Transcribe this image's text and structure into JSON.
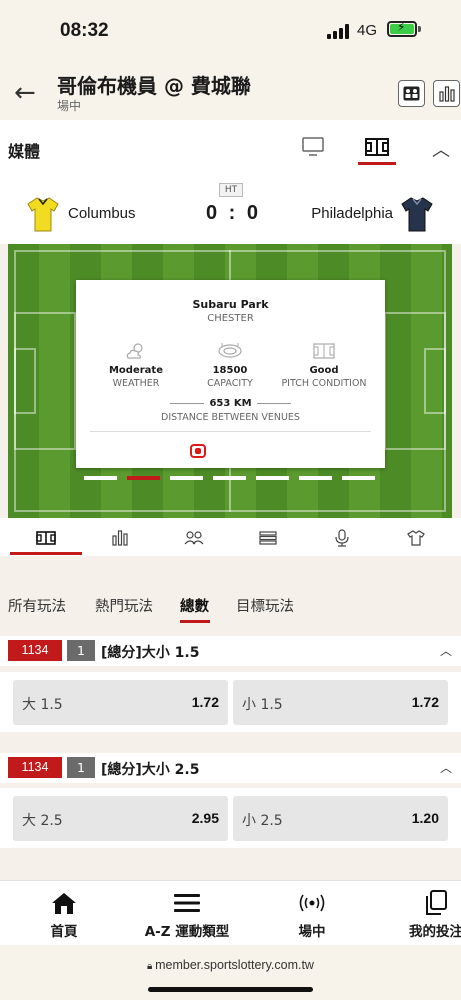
{
  "status_bar": {
    "time": "08:32",
    "network": "4G",
    "battery": "charging"
  },
  "header": {
    "title": "哥倫布機員 @ 費城聯",
    "subtitle": "場中"
  },
  "media": {
    "label": "媒體"
  },
  "match": {
    "period": "HT",
    "home_team": "Columbus",
    "away_team": "Philadelphia",
    "score": "0 : 0",
    "home_shirt_color": "#f2dc21",
    "away_shirt_color": "#25344a"
  },
  "venue_card": {
    "venue": "Subaru Park",
    "city": "CHESTER",
    "stats": [
      {
        "value": "Moderate",
        "label": "WEATHER",
        "icon": "weather-icon"
      },
      {
        "value": "18500",
        "label": "CAPACITY",
        "icon": "stadium-icon"
      },
      {
        "value": "Good",
        "label": "PITCH CONDITION",
        "icon": "pitch-icon"
      }
    ],
    "distance": "653 KM",
    "distance_label": "DISTANCE BETWEEN VENUES"
  },
  "carousel": {
    "count": 7,
    "active_index": 1
  },
  "icon_tabs": [
    "pitch-icon",
    "stats-icon",
    "lineup-icon",
    "standings-icon",
    "commentary-icon",
    "shirt-icon"
  ],
  "market_tabs": [
    {
      "label": "所有玩法",
      "active": false
    },
    {
      "label": "熱門玩法",
      "active": false
    },
    {
      "label": "總數",
      "active": true
    },
    {
      "label": "目標玩法",
      "active": false
    }
  ],
  "markets": [
    {
      "code": "1134",
      "num": "1",
      "name": "[總分]大小 1.5",
      "odds": [
        {
          "label": "大 1.5",
          "value": "1.72"
        },
        {
          "label": "小 1.5",
          "value": "1.72"
        }
      ]
    },
    {
      "code": "1134",
      "num": "1",
      "name": "[總分]大小 2.5",
      "odds": [
        {
          "label": "大 2.5",
          "value": "2.95"
        },
        {
          "label": "小 2.5",
          "value": "1.20"
        }
      ]
    }
  ],
  "bottom_nav": [
    {
      "label": "首頁",
      "icon": "home-icon"
    },
    {
      "label": "A-Z 運動類型",
      "icon": "menu-icon"
    },
    {
      "label": "場中",
      "icon": "live-icon"
    },
    {
      "label": "我的投注",
      "icon": "bets-icon"
    }
  ],
  "browser": {
    "url": "member.sportslottery.com.tw"
  },
  "colors": {
    "accent": "#c21a1a",
    "pitch": "#4d8b26"
  }
}
